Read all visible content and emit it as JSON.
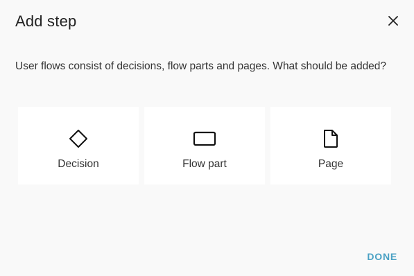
{
  "dialog": {
    "title": "Add step",
    "description": "User flows consist of decisions, flow parts and pages. What should be added?",
    "options": [
      {
        "label": "Decision",
        "icon": "diamond-icon"
      },
      {
        "label": "Flow part",
        "icon": "rectangle-icon"
      },
      {
        "label": "Page",
        "icon": "page-icon"
      }
    ],
    "done_label": "DONE",
    "close_icon": "close-icon"
  },
  "colors": {
    "background": "#f9f9f9",
    "card": "#ffffff",
    "accent": "#4aa1c4",
    "text": "#222222"
  }
}
